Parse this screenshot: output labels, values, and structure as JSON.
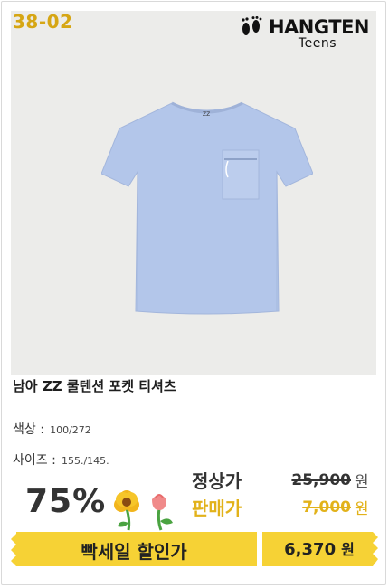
{
  "product_code": "38-02",
  "brand": {
    "name": "HANGTEN",
    "sub": "Teens"
  },
  "product": {
    "title": "남아 ZZ 쿨텐션 포켓 티셔츠",
    "color_label": "색상 :",
    "color_value": "100/272",
    "size_label": "사이즈 :",
    "size_value": "155./145."
  },
  "discount": "75%",
  "prices": {
    "regular_label": "정상가",
    "regular_price": "25,900",
    "sale_label": "판매가",
    "sale_price": "7,000",
    "currency": "원"
  },
  "banner": {
    "label": "빡세일 할인가",
    "price": "6,370",
    "currency": "원"
  },
  "colors": {
    "code": "#d6a614",
    "accent_yellow": "#f6d235",
    "shirt_blue": "#b3c6ea",
    "photo_bg": "#ececea"
  }
}
